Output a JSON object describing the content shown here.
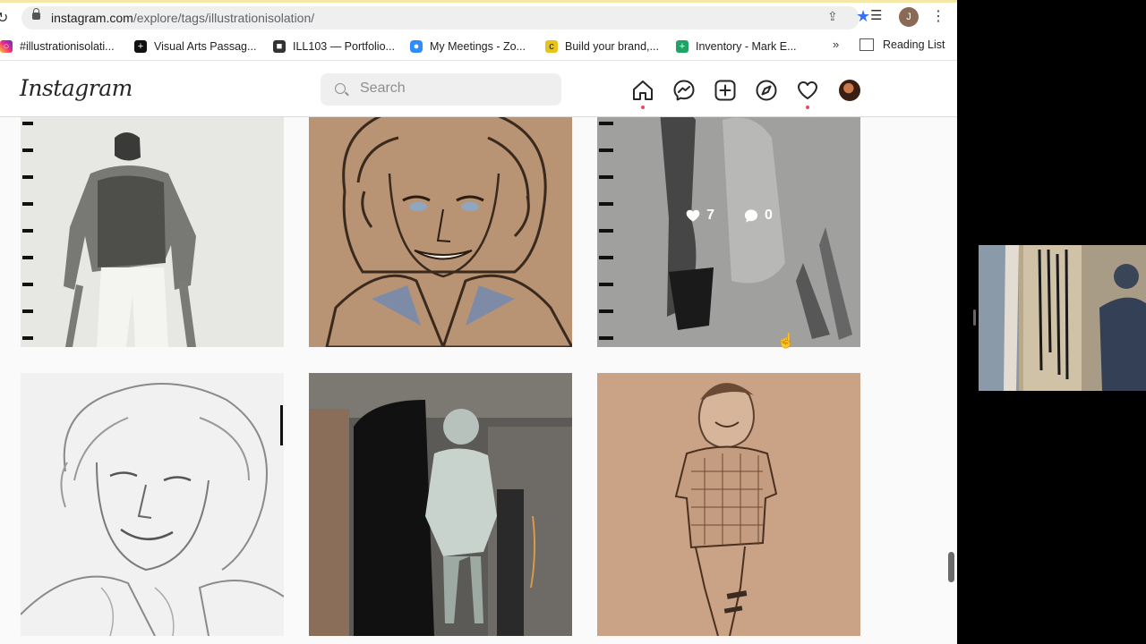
{
  "browser": {
    "url_host": "instagram.com",
    "url_path": "/explore/tags/illustrationisolation/",
    "profile_initial": "J",
    "accent_color": "#3b6ff5"
  },
  "bookmarks": {
    "items": [
      {
        "label": "#illustrationisolati...",
        "icon": "instagram-icon",
        "color": "#d6249f"
      },
      {
        "label": "Visual Arts Passag...",
        "icon": "plus-square-icon",
        "color": "#111111"
      },
      {
        "label": "ILL103 — Portfolio...",
        "icon": "portfolio-icon",
        "color": "#333333"
      },
      {
        "label": "My Meetings - Zo...",
        "icon": "zoom-icon",
        "color": "#2d8cff"
      },
      {
        "label": "Build your brand,...",
        "icon": "brand-icon",
        "color": "#e8c31c"
      },
      {
        "label": "Inventory - Mark E...",
        "icon": "sheets-plus-icon",
        "color": "#1fa463"
      }
    ],
    "more": "»",
    "reading_list": "Reading List"
  },
  "instagram": {
    "logo": "Instagram",
    "search_placeholder": "Search",
    "nav": [
      "home-icon",
      "messenger-icon",
      "new-post-icon",
      "explore-icon",
      "activity-icon",
      "profile-avatar"
    ],
    "notification_color": "#ed4956"
  },
  "grid": {
    "hover_stats": {
      "likes": "7",
      "comments": "0"
    },
    "tiles": [
      {
        "subject": "ink wash figure in sketchbook"
      },
      {
        "subject": "curly-haired woman portrait on toned paper"
      },
      {
        "subject": "grey wash sketch of figures"
      },
      {
        "subject": "pencil portrait of smiling woman"
      },
      {
        "subject": "painted child figure in doorway"
      },
      {
        "subject": "pencil drawing of smiling child"
      }
    ]
  }
}
